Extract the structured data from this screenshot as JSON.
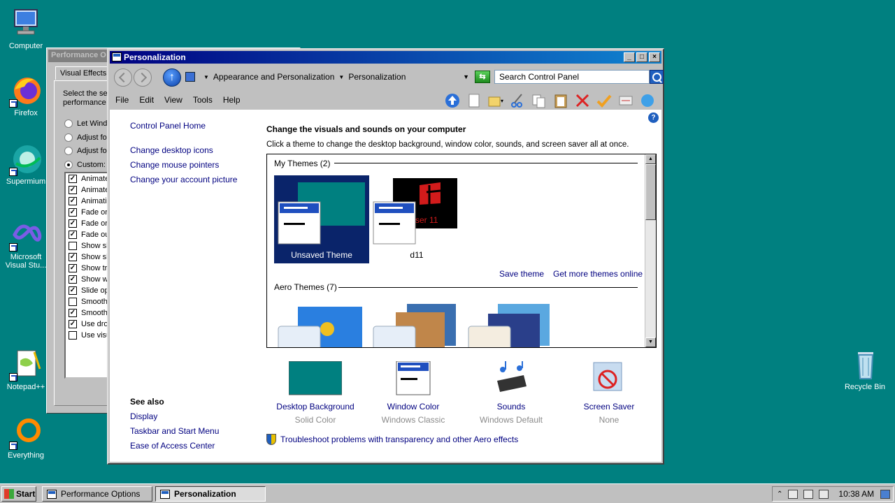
{
  "desktop": {
    "icons": [
      {
        "label": "Computer",
        "icon": "computer-icon"
      },
      {
        "label": "Firefox",
        "icon": "firefox-icon"
      },
      {
        "label": "Supermium",
        "icon": "supermium-icon"
      },
      {
        "label": "Microsoft Visual Stu...",
        "icon": "visual-studio-icon"
      },
      {
        "label": "Notepad++",
        "icon": "notepadpp-icon"
      },
      {
        "label": "Everything",
        "icon": "everything-icon"
      },
      {
        "label": "Recycle Bin",
        "icon": "recycle-bin-icon"
      }
    ]
  },
  "perf_window": {
    "title": "Performance O",
    "tab": "Visual Effects",
    "desc_line1": "Select the se",
    "desc_line2": "performance",
    "radios": [
      {
        "label": "Let Windo",
        "checked": false
      },
      {
        "label": "Adjust fo",
        "checked": false
      },
      {
        "label": "Adjust fo",
        "checked": false
      },
      {
        "label": "Custom:",
        "checked": true
      }
    ],
    "checks": [
      {
        "label": "Animate",
        "checked": true
      },
      {
        "label": "Animate",
        "checked": true
      },
      {
        "label": "Animati",
        "checked": true
      },
      {
        "label": "Fade or",
        "checked": true
      },
      {
        "label": "Fade or",
        "checked": true
      },
      {
        "label": "Fade ou",
        "checked": true
      },
      {
        "label": "Show sh",
        "checked": false
      },
      {
        "label": "Show sh",
        "checked": true
      },
      {
        "label": "Show tr",
        "checked": true
      },
      {
        "label": "Show w",
        "checked": true
      },
      {
        "label": "Slide op",
        "checked": true
      },
      {
        "label": "Smooth",
        "checked": false
      },
      {
        "label": "Smooth",
        "checked": true
      },
      {
        "label": "Use dro",
        "checked": true
      },
      {
        "label": "Use visu",
        "checked": false
      }
    ]
  },
  "window": {
    "title": "Personalization",
    "controls": {
      "minimize": "_",
      "maximize": "□",
      "close": "×"
    },
    "breadcrumb": [
      "Appearance and Personalization",
      "Personalization"
    ],
    "search_placeholder": "Search Control Panel",
    "menu": [
      "File",
      "Edit",
      "View",
      "Tools",
      "Help"
    ],
    "sidebar": {
      "home": "Control Panel Home",
      "tasks": [
        "Change desktop icons",
        "Change mouse pointers",
        "Change your account picture"
      ],
      "see_also_title": "See also",
      "see_also": [
        "Display",
        "Taskbar and Start Menu",
        "Ease of Access Center"
      ]
    },
    "main": {
      "title": "Change the visuals and sounds on your computer",
      "description": "Click a theme to change the desktop background, window color, sounds, and screen saver all at once.",
      "my_themes_header": "My Themes (2)",
      "my_themes": [
        {
          "name": "Unsaved Theme",
          "selected": true
        },
        {
          "name": "d11",
          "selected": false,
          "image_text": "vser 11"
        }
      ],
      "save_theme": "Save theme",
      "more_themes": "Get more themes online",
      "aero_header": "Aero Themes (7)",
      "bottom_items": [
        {
          "label": "Desktop Background",
          "sub": "Solid Color"
        },
        {
          "label": "Window Color",
          "sub": "Windows Classic"
        },
        {
          "label": "Sounds",
          "sub": "Windows Default"
        },
        {
          "label": "Screen Saver",
          "sub": "None"
        }
      ],
      "troubleshoot": "Troubleshoot problems with transparency and other Aero effects"
    }
  },
  "taskbar": {
    "start": "Start",
    "buttons": [
      {
        "label": "Performance Options",
        "active": false
      },
      {
        "label": "Personalization",
        "active": true
      }
    ],
    "time": "10:38 AM"
  },
  "colors": {
    "desktop": "#008080",
    "titlebar": "#000080",
    "link": "#000080"
  }
}
